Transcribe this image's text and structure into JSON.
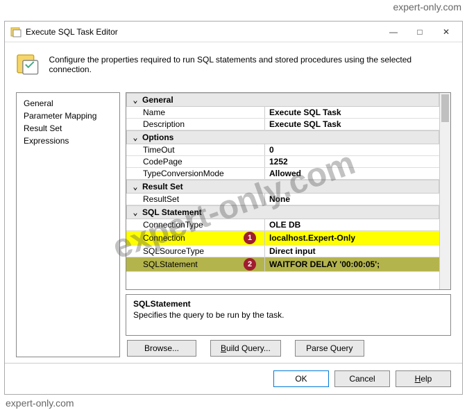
{
  "watermark": {
    "top": "expert-only.com",
    "center": "expert-only.com",
    "bottom": "expert-only.com"
  },
  "titlebar": {
    "title": "Execute SQL Task Editor",
    "min": "—",
    "max": "□",
    "close": "✕"
  },
  "header": {
    "text": "Configure the properties required to run SQL statements and stored procedures using the selected connection."
  },
  "sidebar": {
    "items": [
      "General",
      "Parameter Mapping",
      "Result Set",
      "Expressions"
    ]
  },
  "propgrid": {
    "categories": [
      {
        "name": "General",
        "toggle": "⌄",
        "rows": [
          {
            "label": "Name",
            "value": "Execute SQL Task"
          },
          {
            "label": "Description",
            "value": "Execute SQL Task"
          }
        ]
      },
      {
        "name": "Options",
        "toggle": "⌄",
        "rows": [
          {
            "label": "TimeOut",
            "value": "0"
          },
          {
            "label": "CodePage",
            "value": "1252"
          },
          {
            "label": "TypeConversionMode",
            "value": "Allowed"
          }
        ]
      },
      {
        "name": "Result Set",
        "toggle": "⌄",
        "rows": [
          {
            "label": "ResultSet",
            "value": "None"
          }
        ]
      },
      {
        "name": "SQL Statement",
        "toggle": "⌄",
        "rows": [
          {
            "label": "ConnectionType",
            "value": "OLE DB"
          },
          {
            "label": "Connection",
            "value": "localhost.Expert-Only",
            "hi": "yellow",
            "badge": "1"
          },
          {
            "label": "SQLSourceType",
            "value": "Direct input"
          },
          {
            "label": "SQLStatement",
            "value": "WAITFOR DELAY '00:00:05';",
            "hi": "olive",
            "badge": "2"
          }
        ]
      }
    ]
  },
  "desc": {
    "title": "SQLStatement",
    "text": "Specifies the query to be run by the task."
  },
  "actions": {
    "browse": "Browse...",
    "build": "Build Query...",
    "parse": "Parse Query"
  },
  "footer": {
    "ok": "OK",
    "cancel": "Cancel",
    "help": "Help"
  }
}
